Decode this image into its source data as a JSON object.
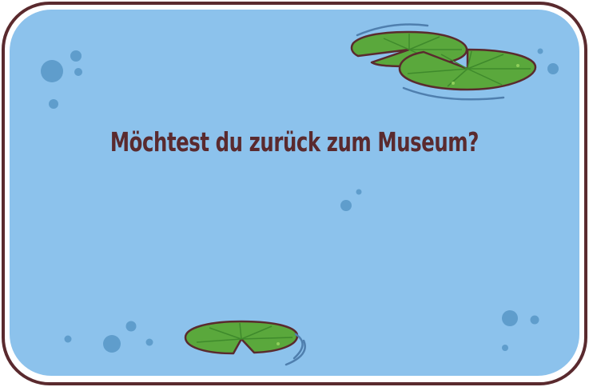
{
  "dialog": {
    "question": "Möchtest du zurück zum Museum?"
  },
  "colors": {
    "water": "#8cc2ec",
    "border": "#5a2a2e",
    "rim": "#ffffff",
    "lily_pad": "#5aa83c",
    "lily_pad_dark": "#3f8a2c",
    "bubble": "#5f9dcc",
    "ripple": "#4f7fae"
  },
  "icons": [
    "lily-pad-icon",
    "bubble-icon",
    "ripple-icon"
  ]
}
